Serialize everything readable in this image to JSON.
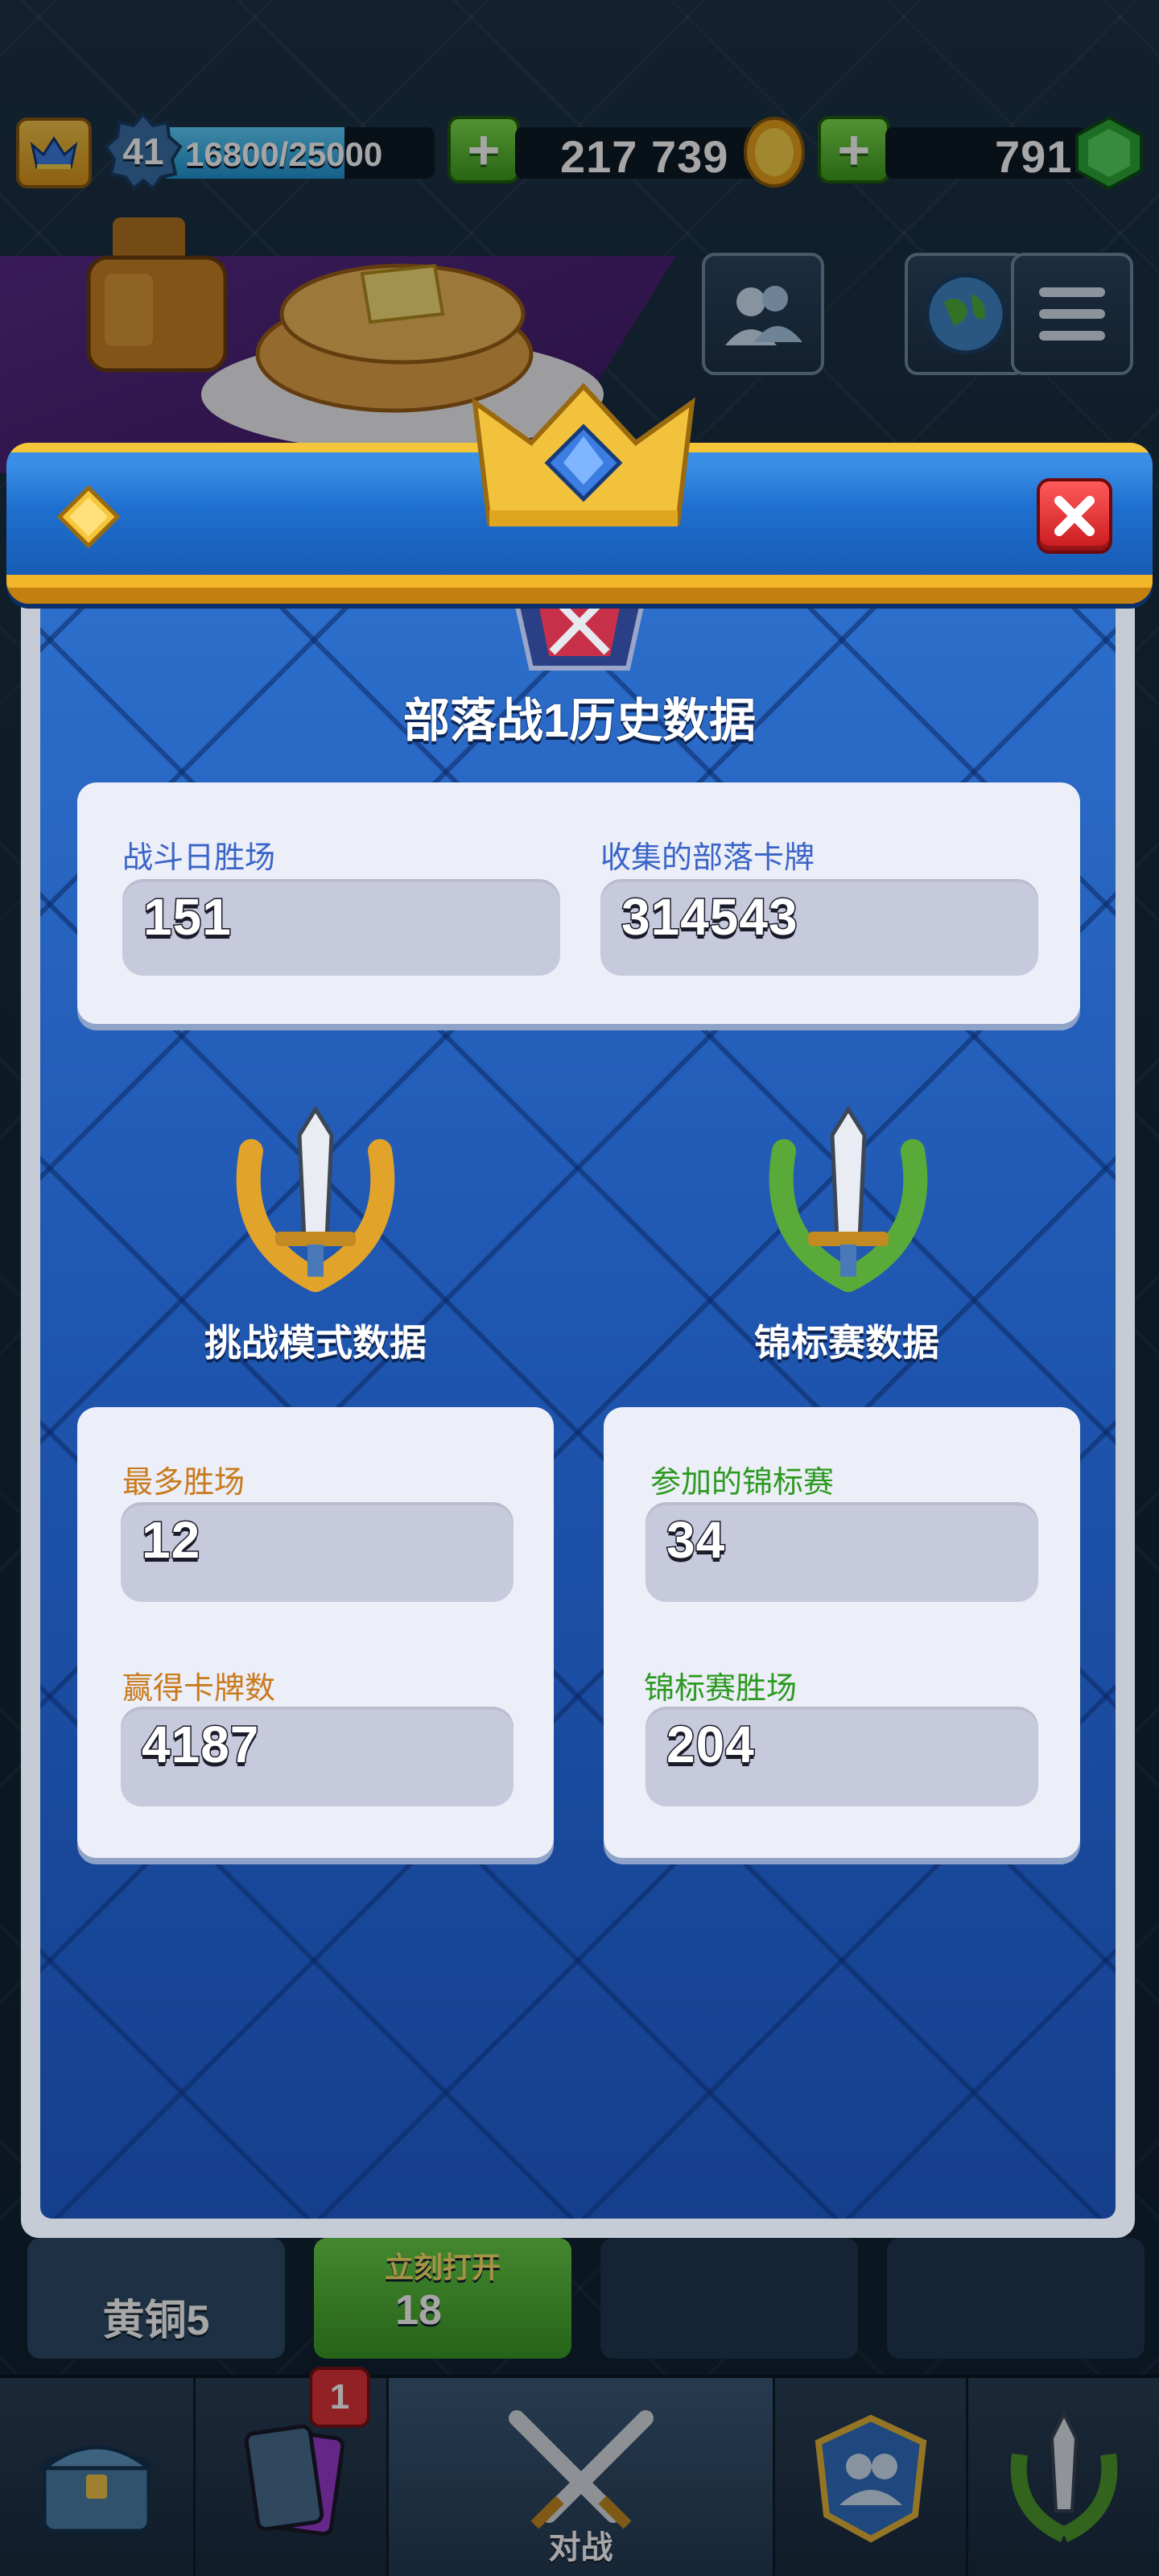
{
  "topbar": {
    "level": "41",
    "xp_text": "16800/25000",
    "xp_progress": 0.672,
    "gold": "217 739",
    "gems": "791"
  },
  "background": {
    "bottom_tiles": {
      "arena_label": "黄铜5",
      "chest_label": "立刻打开",
      "chest_cost": "18"
    },
    "navbar": {
      "battle_label": "对战",
      "cards_badge": "1"
    }
  },
  "modal": {
    "title": "部落战1历史数据",
    "clan_war": {
      "battle_day_wins_label": "战斗日胜场",
      "battle_day_wins_value": "151",
      "clan_cards_collected_label": "收集的部落卡牌",
      "clan_cards_collected_value": "314543"
    },
    "challenge": {
      "title": "挑战模式数据",
      "max_wins_label": "最多胜场",
      "max_wins_value": "12",
      "cards_won_label": "赢得卡牌数",
      "cards_won_value": "4187"
    },
    "tournament": {
      "title": "锦标赛数据",
      "tournaments_played_label": "参加的锦标赛",
      "tournaments_played_value": "34",
      "tournament_wins_label": "锦标赛胜场",
      "tournament_wins_value": "204"
    }
  },
  "colors": {
    "panel_blue": "#1f56b0",
    "card_bg": "#eceef8",
    "value_box": "#c7c9dc",
    "label_blue": "#3a64c8",
    "label_orange": "#c97a1c",
    "label_green": "#2c9a20",
    "close_red": "#e0343a",
    "gold_trim": "#f3b52a"
  }
}
